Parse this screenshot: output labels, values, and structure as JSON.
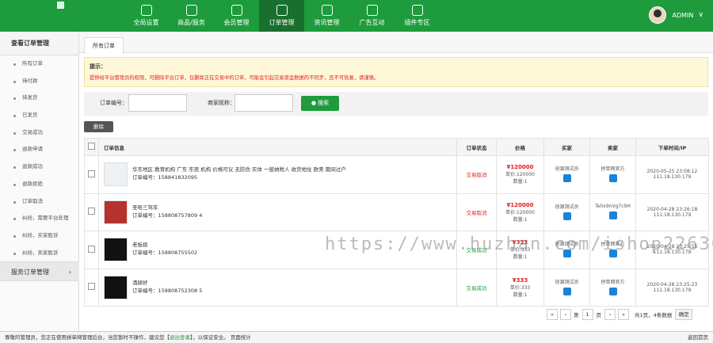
{
  "nav": {
    "items": [
      {
        "label": "全局设置",
        "icon": "grid-icon"
      },
      {
        "label": "商品/服务",
        "icon": "user-icon"
      },
      {
        "label": "会员管理",
        "icon": "book-icon"
      },
      {
        "label": "订单管理",
        "icon": "camera-icon"
      },
      {
        "label": "资讯管理",
        "icon": "calendar-icon"
      },
      {
        "label": "广告互动",
        "icon": "gear-icon"
      },
      {
        "label": "插件专区",
        "icon": "inbox-icon"
      }
    ],
    "active_index": 3
  },
  "user": {
    "name": "ADMIN"
  },
  "sidebar": {
    "title": "查看订单管理",
    "items": [
      "所有订单",
      "待付款",
      "待发货",
      "已发货",
      "交易成功",
      "退款申请",
      "退款成功",
      "退款拒绝",
      "订单取消",
      "纠纷，需要平台处理",
      "纠纷，买家胜诉",
      "纠纷，卖家胜诉"
    ],
    "footer": "服务订单管理"
  },
  "tab": {
    "label": "所有订单"
  },
  "tips": {
    "title": "提示：",
    "text": "提供给平台管理员的权限，可删除平台订单，仅删除正在交易中的订单，可能会引起交易资金数据的不同步，且不可恢复，请谨慎。"
  },
  "search": {
    "order_no_label": "订单编号：",
    "seller_label": "商家昵称：",
    "button": "搜索"
  },
  "delete_button": "删除",
  "table": {
    "headers": [
      "订单信息",
      "订单状态",
      "价格",
      "买家",
      "卖家",
      "下单时间/IP"
    ],
    "rows": [
      {
        "title": "华东地区 教育机构 广东 东莞 机构 价格可议 无防伪 实体 一般纳税人 收货地址 欧美 期间过户",
        "order_no": "订单编号：158841832095",
        "status": "交易取消",
        "status_color": "#e02020",
        "price": "¥120000",
        "unit": "单价:120000",
        "qty": "数量:1",
        "buyer": "创源测试员",
        "seller": "拼单网官方",
        "time": "2020-05-25 23:08:12",
        "ip": "111.18.130.179"
      },
      {
        "title": "圣哈三驾车",
        "order_no": "订单编号：158808757809 4",
        "status": "交易取消",
        "status_color": "#e02020",
        "price": "¥120000",
        "unit": "单价:120000",
        "qty": "数量:1",
        "buyer": "创源测试员",
        "seller": "Tehx9nVg7c9H",
        "time": "2020-04-28 23:26:18",
        "ip": "111.18.130.179"
      },
      {
        "title": "老板娘",
        "order_no": "订单编号：158808755502",
        "status": "交易成功",
        "status_color": "#1f9b3c",
        "price": "¥333",
        "unit": "单价:333",
        "qty": "数量:1",
        "buyer": "创源测试员",
        "seller": "拼单网官方",
        "time": "2020-04-28 23:25:55",
        "ip": "111.18.130.179"
      },
      {
        "title": "酒肆好",
        "order_no": "订单编号：158808752308 5",
        "status": "交易成功",
        "status_color": "#1f9b3c",
        "price": "¥333",
        "unit": "单价:333",
        "qty": "数量:1",
        "buyer": "创源测试员",
        "seller": "拼单网官方",
        "time": "2020-04-28 23:25:23",
        "ip": "111.18.130.179"
      }
    ]
  },
  "pager": {
    "prefix": "第",
    "page": "1",
    "suffix": "页",
    "summary": "共1页，4条数据",
    "ok": "确定"
  },
  "footer": {
    "text": "尊敬的管理员，您正在使用拼单网管理后台，当您暂时不操作，建议您【",
    "link": "退出登录",
    "text2": "】，以保证安全。 页面统计",
    "right": "返回首页"
  },
  "watermark": "https://www.huzhan.com/ishop22636"
}
